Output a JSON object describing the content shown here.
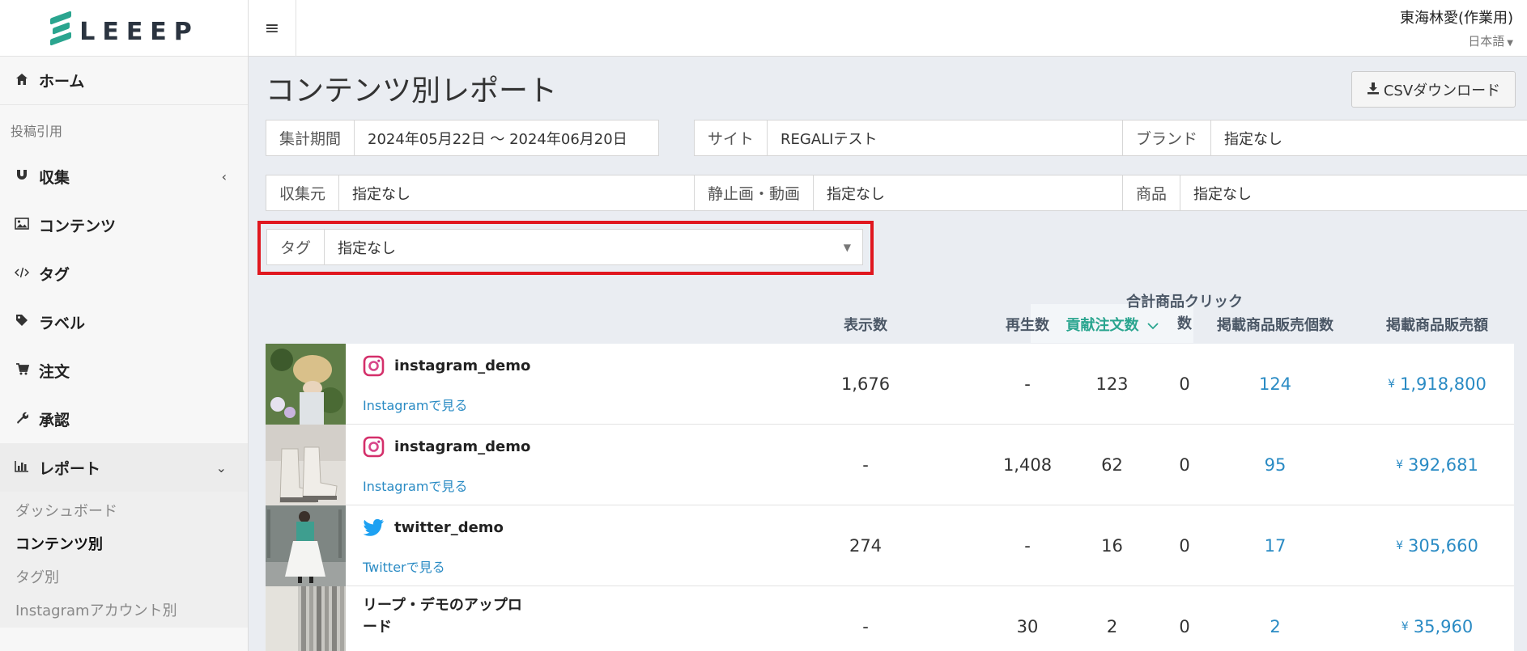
{
  "brand": {
    "logo_text": "LEEEP",
    "accent": "#2aa58f"
  },
  "sidebar": {
    "home_label": "ホーム",
    "section_label": "投稿引用",
    "items": [
      {
        "label": "収集",
        "icon": "magnet-icon"
      },
      {
        "label": "コンテンツ",
        "icon": "image-icon"
      },
      {
        "label": "タグ",
        "icon": "code-icon"
      },
      {
        "label": "ラベル",
        "icon": "tag-icon"
      },
      {
        "label": "注文",
        "icon": "cart-icon"
      },
      {
        "label": "承認",
        "icon": "wrench-icon"
      },
      {
        "label": "レポート",
        "icon": "bar-chart-icon"
      }
    ],
    "report_sub": [
      {
        "label": "ダッシュボード"
      },
      {
        "label": "コンテンツ別"
      },
      {
        "label": "タグ別"
      },
      {
        "label": "Instagramアカウント別"
      }
    ]
  },
  "topbar": {
    "user_name": "東海林愛(作業用)",
    "language": "日本語"
  },
  "page": {
    "title": "コンテンツ別レポート",
    "csv_button": "CSVダウンロード"
  },
  "filters": {
    "period": {
      "label": "集計期間",
      "value": "2024年05月22日 ～ 2024年06月20日"
    },
    "site": {
      "label": "サイト",
      "value": "REGALIテスト"
    },
    "brand": {
      "label": "ブランド",
      "value": "指定なし"
    },
    "source": {
      "label": "収集元",
      "value": "指定なし"
    },
    "media": {
      "label": "静止画・動画",
      "value": "指定なし"
    },
    "product": {
      "label": "商品",
      "value": "指定なし"
    },
    "tag": {
      "label": "タグ",
      "value": "指定なし"
    }
  },
  "table": {
    "headers": {
      "impressions": "表示数",
      "plays": "再生数",
      "clicks": "合計商品クリック数",
      "orders": "貢献注文数",
      "units": "掲載商品販売個数",
      "sales": "掲載商品販売額"
    },
    "currency": "¥",
    "rows": [
      {
        "account": "instagram_demo",
        "platform": "instagram",
        "link": "Instagramで見る",
        "impressions": "1,676",
        "plays": "-",
        "clicks": "0",
        "orders": "123",
        "units": "124",
        "sales": "1,918,800"
      },
      {
        "account": "instagram_demo",
        "platform": "instagram",
        "link": "Instagramで見る",
        "impressions": "-",
        "plays": "1,408",
        "clicks": "0",
        "orders": "62",
        "units": "95",
        "sales": "392,681"
      },
      {
        "account": "twitter_demo",
        "platform": "twitter",
        "link": "Twitterで見る",
        "impressions": "274",
        "plays": "-",
        "clicks": "0",
        "orders": "16",
        "units": "17",
        "sales": "305,660"
      },
      {
        "account": "リープ・デモのアップロード",
        "platform": "upload",
        "link": "",
        "impressions": "-",
        "plays": "30",
        "clicks": "0",
        "orders": "2",
        "units": "2",
        "sales": "35,960"
      }
    ]
  }
}
